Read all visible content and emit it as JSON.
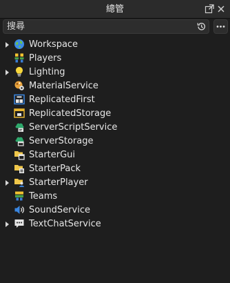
{
  "window": {
    "title": "總管"
  },
  "search": {
    "placeholder": "搜尋",
    "value": ""
  },
  "colors": {
    "background": "#1e1e1e",
    "titlebar": "#2b2b2b",
    "text": "#e6e6e6"
  },
  "tree": {
    "items": [
      {
        "label": "Workspace",
        "icon": "globe-icon",
        "expandable": true
      },
      {
        "label": "Players",
        "icon": "players-icon",
        "expandable": false
      },
      {
        "label": "Lighting",
        "icon": "lightbulb-icon",
        "expandable": true
      },
      {
        "label": "MaterialService",
        "icon": "material-service-icon",
        "expandable": false
      },
      {
        "label": "ReplicatedFirst",
        "icon": "replicated-first-icon",
        "expandable": false
      },
      {
        "label": "ReplicatedStorage",
        "icon": "replicated-storage-icon",
        "expandable": false
      },
      {
        "label": "ServerScriptService",
        "icon": "server-script-service-icon",
        "expandable": false
      },
      {
        "label": "ServerStorage",
        "icon": "server-storage-icon",
        "expandable": false
      },
      {
        "label": "StarterGui",
        "icon": "starter-gui-icon",
        "expandable": false
      },
      {
        "label": "StarterPack",
        "icon": "starter-pack-icon",
        "expandable": false
      },
      {
        "label": "StarterPlayer",
        "icon": "starter-player-icon",
        "expandable": true
      },
      {
        "label": "Teams",
        "icon": "teams-icon",
        "expandable": false
      },
      {
        "label": "SoundService",
        "icon": "sound-icon",
        "expandable": false
      },
      {
        "label": "TextChatService",
        "icon": "chat-icon",
        "expandable": true
      }
    ]
  }
}
